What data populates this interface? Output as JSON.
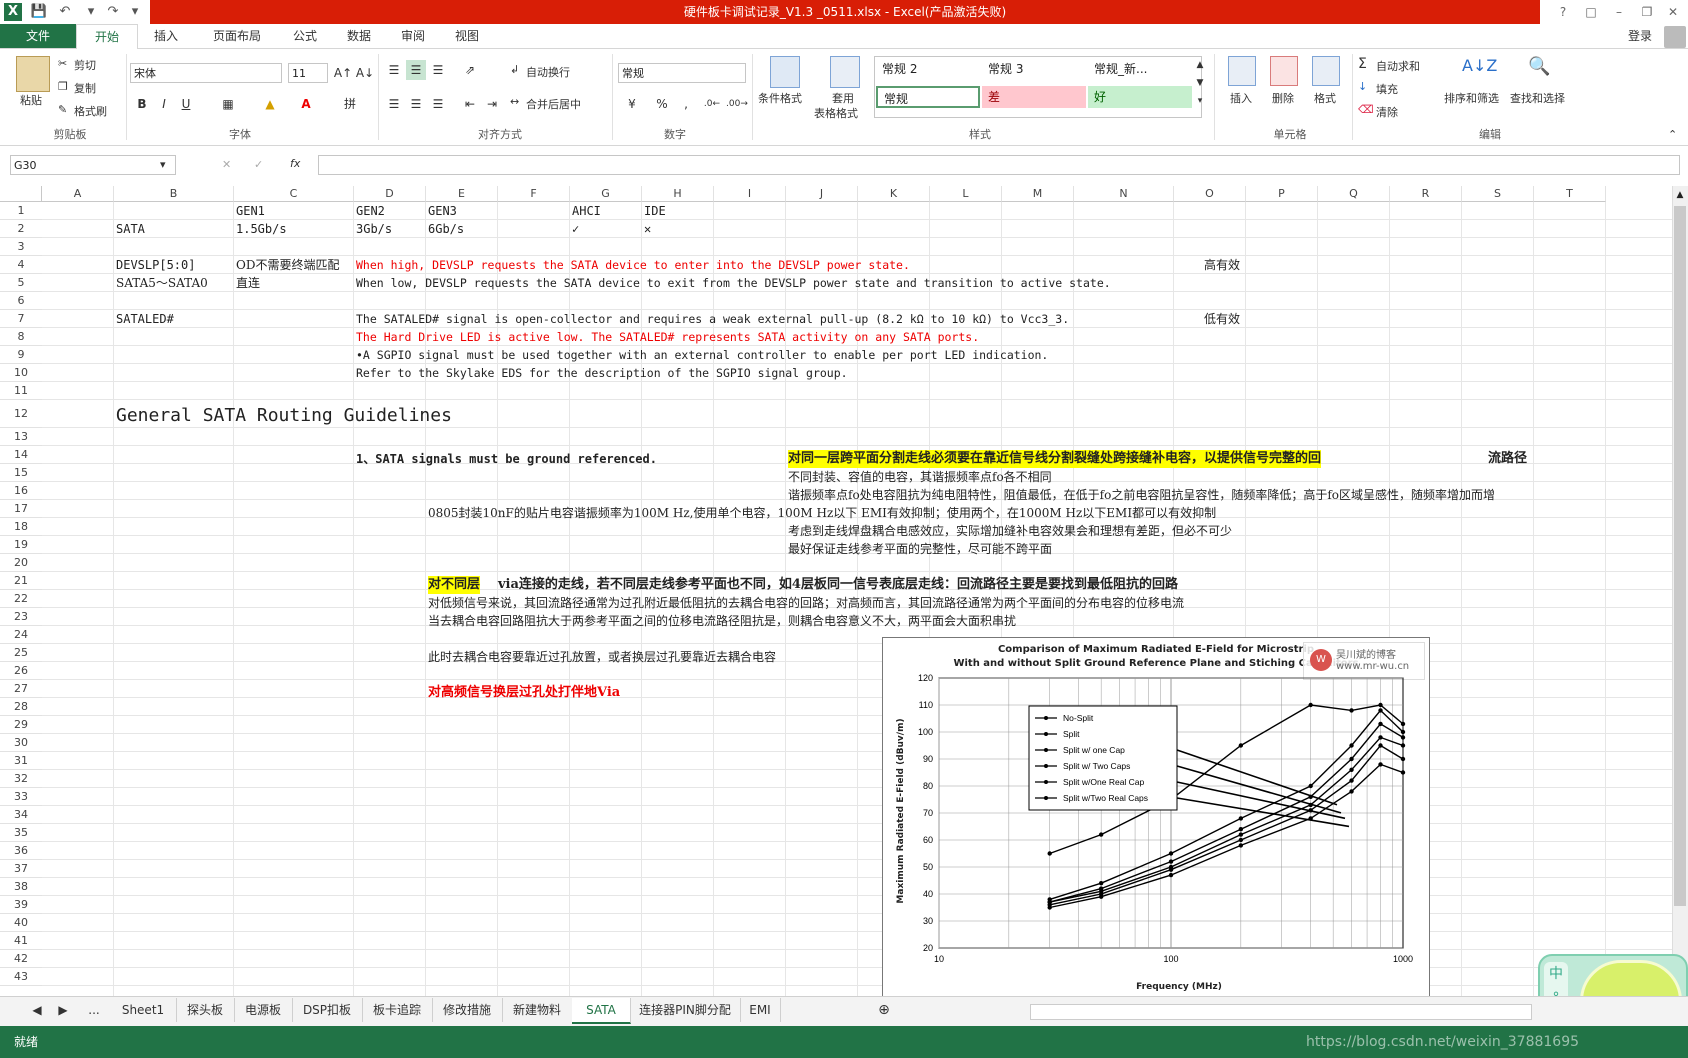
{
  "title": "硬件板卡调试记录_V1.3 _0511.xlsx -  Excel(产品激活失败)",
  "login": "登录",
  "tabs": [
    "文件",
    "开始",
    "插入",
    "页面布局",
    "公式",
    "数据",
    "审阅",
    "视图"
  ],
  "clipboard": {
    "paste": "粘贴",
    "cut": "剪切",
    "copy": "复制",
    "format_painter": "格式刷",
    "group": "剪贴板"
  },
  "font": {
    "name": "宋体",
    "size": "11",
    "group": "字体",
    "bold": "B",
    "italic": "I",
    "underline": "U"
  },
  "alignment": {
    "wrap": "自动换行",
    "merge": "合并后居中",
    "group": "对齐方式"
  },
  "number": {
    "format": "常规",
    "group": "数字",
    "percent": "%",
    "comma": ","
  },
  "styles": {
    "conditional": "条件格式",
    "table_line1": "套用",
    "table_line2": "表格格式",
    "items": [
      "常规 2",
      "常规 3",
      "常规_新...",
      "常规",
      "差",
      "好"
    ],
    "group": "样式"
  },
  "cells": {
    "insert": "插入",
    "delete": "删除",
    "format": "格式",
    "group": "单元格"
  },
  "editing": {
    "autosum": "自动求和",
    "fill": "填充",
    "clear": "清除",
    "sort": "排序和筛选",
    "find": "查找和选择",
    "group": "编辑"
  },
  "formula_bar": {
    "namebox": "G30",
    "fx": "fx",
    "cancel": "✕",
    "enter": "✓",
    "content": ""
  },
  "columns": [
    "A",
    "B",
    "C",
    "D",
    "E",
    "F",
    "G",
    "H",
    "I",
    "J",
    "K",
    "L",
    "M",
    "N",
    "O",
    "P",
    "Q",
    "R",
    "S",
    "T"
  ],
  "rows": [
    "1",
    "2",
    "3",
    "4",
    "5",
    "6",
    "7",
    "8",
    "9",
    "10",
    "11",
    "12",
    "13",
    "14",
    "15",
    "16",
    "17",
    "18",
    "19",
    "20",
    "21",
    "22",
    "23",
    "24",
    "25",
    "26",
    "27",
    "28",
    "29",
    "30",
    "31",
    "32",
    "33",
    "34",
    "35",
    "36",
    "37",
    "38",
    "39",
    "40",
    "41",
    "42",
    "43"
  ],
  "cells_content": {
    "c1": "GEN1",
    "d1": "GEN2",
    "e1": "GEN3",
    "g1": "AHCI",
    "h1": "IDE",
    "b2": "SATA",
    "c2": "1.5Gb/s",
    "d2": "3Gb/s",
    "e2": "6Gb/s",
    "g2": "✓",
    "h2": "✕",
    "b4": "DEVSLP[5:0]",
    "c4": "OD不需要终端匹配",
    "d4": "When high, DEVSLP requests the SATA device to enter into the DEVSLP power state.",
    "o4": "高有效",
    "b5": "SATA5～SATA0",
    "c5": "直连",
    "d5": "When low, DEVSLP requests the SATA device to exit from the DEVSLP power state and transition to active state.",
    "b7": "SATALED#",
    "d7": "The SATALED# signal is open-collector and requires a weak external pull-up (8.2 kΩ to 10 kΩ) to Vcc3_3.",
    "o7": "低有效",
    "d8": "The Hard Drive LED is active low. The SATALED# represents SATA activity on any SATA ports.",
    "d9": "•A SGPIO signal must be used together with an external controller to enable per port LED indication.",
    "d10": "Refer to the Skylake EDS for the description of the SGPIO signal group.",
    "b12": "General SATA Routing Guidelines",
    "d14": "1、SATA signals must be ground referenced.",
    "j14": "对同一层跨平面分割走线必须要在靠近信号线分割裂缝处跨接缝补电容，以提供信号完整的回",
    "j14b": "流路径",
    "j15": "不同封装、容值的电容，其谐振频率点fo各不相同",
    "j16": "谐振频率点fo处电容阻抗为纯电阻特性，阻值最低，在低于fo之前电容阻抗呈容性，随频率降低；高于fo区域呈感性，随频率增加而增",
    "e17": "0805封装10nF的贴片电容谐振频率为100M Hz,使用单个电容，100M Hz以下 EMI有效抑制；使用两个，在1000M Hz以下EMI都可以有效抑制",
    "j18": "考虑到走线焊盘耦合电感效应，实际增加缝补电容效果会和理想有差距，但必不可少",
    "j19": "最好保证走线参考平面的完整性，尽可能不跨平面",
    "e21a": "对不同层",
    "e21b": "via连接的走线，若不同层走线参考平面也不同，如4层板同一信号表底层走线：回流路径主要是要找到最低阻抗的回路",
    "e22": "对低频信号来说，其回流路径通常为过孔附近最低阻抗的去耦合电容的回路；对高频而言，其回流路径通常为两个平面间的分布电容的位移电流",
    "e23": "当去耦合电容回路阻抗大于两参考平面之间的位移电流路径阻抗是，则耦合电容意义不大，两平面会大面积串扰",
    "e25": "此时去耦合电容要靠近过孔放置，或者换层过孔要靠近去耦合电容",
    "e27": "对高频信号换层过孔处打伴地Via"
  },
  "embedded_chart": {
    "title1": "Comparison of Maximum Radiated E-Field for Microstrip",
    "title2": "With and without Split Ground Reference Plane and Stiching Capacitors",
    "ylabel": "Maximum Radiated E-Field (dBuv/m)",
    "xlabel": "Frequency (MHz)",
    "yticks": [
      "120",
      "110",
      "100",
      "90",
      "80",
      "70",
      "60",
      "50",
      "40",
      "30",
      "20"
    ],
    "xticks": [
      "10",
      "100",
      "1000"
    ],
    "legend": [
      "No-Split",
      "Split",
      "Split w/ one Cap",
      "Split w/ Two Caps",
      "Split w/One Real Cap",
      "Split w/Two Real Caps"
    ],
    "watermark1": "吴川斌的博客",
    "watermark2": "www.mr-wu.cn"
  },
  "chart_data": {
    "type": "line",
    "title": "Comparison of Maximum Radiated E-Field for Microstrip With and without Split Ground Reference Plane and Stiching Capacitors",
    "xlabel": "Frequency (MHz)",
    "ylabel": "Maximum Radiated E-Field (dBuv/m)",
    "xscale": "log",
    "xlim": [
      10,
      1000
    ],
    "ylim": [
      20,
      120
    ],
    "x": [
      30,
      50,
      100,
      200,
      400,
      600,
      800,
      1000
    ],
    "series": [
      {
        "name": "No-Split",
        "values": [
          55,
          62,
          75,
          95,
          110,
          108,
          110,
          103
        ]
      },
      {
        "name": "Split",
        "values": [
          38,
          44,
          55,
          68,
          80,
          95,
          108,
          100
        ]
      },
      {
        "name": "Split w/ one Cap",
        "values": [
          37,
          42,
          52,
          64,
          76,
          90,
          103,
          98
        ]
      },
      {
        "name": "Split w/ Two Caps",
        "values": [
          37,
          41,
          50,
          62,
          73,
          86,
          98,
          95
        ]
      },
      {
        "name": "Split w/One Real Cap",
        "values": [
          36,
          40,
          49,
          60,
          71,
          82,
          95,
          90
        ]
      },
      {
        "name": "Split w/Two Real Caps",
        "values": [
          35,
          39,
          47,
          58,
          68,
          78,
          88,
          85
        ]
      }
    ]
  },
  "sheets": [
    "Sheet1",
    "探头板",
    "电源板",
    "DSP扣板",
    "板卡追踪",
    "修改措施",
    "新建物料",
    "SATA",
    "连接器PIN脚分配",
    "EMI"
  ],
  "active_sheet": "SATA",
  "status": "就绪",
  "watermark_url": "https://blog.csdn.net/weixin_37881695",
  "ime": {
    "lang": "中"
  }
}
